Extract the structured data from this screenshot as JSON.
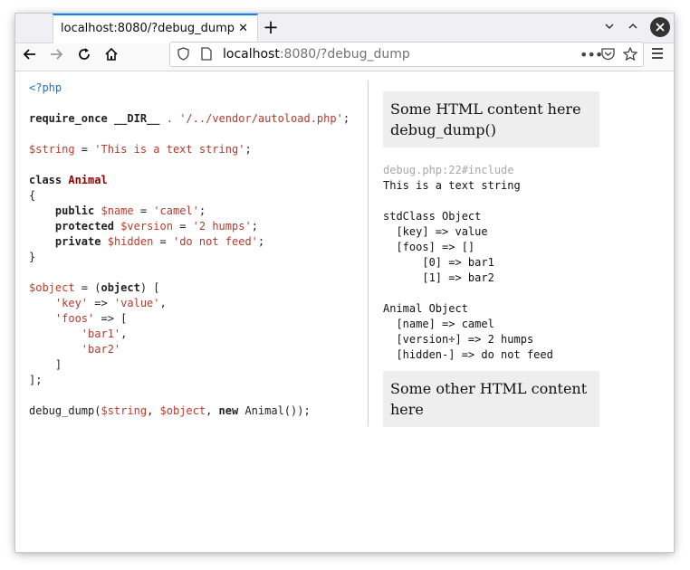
{
  "browser": {
    "tab_title": "localhost:8080/?debug_dump",
    "tab_close": "✕",
    "new_tab": "+",
    "url_host": "localhost",
    "url_rest": ":8080/?debug_dump",
    "buttons": {
      "back": "back-arrow-icon",
      "forward": "forward-arrow-icon",
      "reload": "reload-icon",
      "home": "home-icon",
      "page_actions": "ellipsis-icon",
      "pocket": "pocket-icon",
      "bookmark": "star-icon",
      "menu": "hamburger-icon"
    },
    "accent_color": "#0a84ff"
  },
  "code": {
    "open_tag": "<?php",
    "require_kw": "require_once",
    "dir_const": "__DIR__",
    "concat": " . ",
    "autoload_str": "'/../vendor/autoload.php'",
    "string_var": "$string",
    "string_val": "'This is a text string'",
    "class_kw": "class",
    "class_name": "Animal",
    "public_kw": "public",
    "name_var": "$name",
    "name_val": "'camel'",
    "protected_kw": "protected",
    "version_var": "$version",
    "version_val": "'2 humps'",
    "private_kw": "private",
    "hidden_var": "$hidden",
    "hidden_val": "'do not feed'",
    "object_var": "$object",
    "object_cast": "object",
    "key_str": "'key'",
    "value_str": "'value'",
    "foos_str": "'foos'",
    "bar1_str": "'bar1'",
    "bar2_str": "'bar2'",
    "call_fn": "debug_dump(",
    "new_kw": "new",
    "new_class": " Animal());"
  },
  "output": {
    "block1_line1": "Some HTML content here",
    "block1_line2": "debug_dump()",
    "source": "debug.php:22#include",
    "dump_lines": [
      "This is a text string",
      "",
      "stdClass Object",
      "  [key] => value",
      "  [foos] => []",
      "      [0] => bar1",
      "      [1] => bar2",
      "",
      "Animal Object",
      "  [name] => camel",
      "  [version÷] => 2 humps",
      "  [hidden-] => do not feed"
    ],
    "block2": "Some other HTML content here"
  }
}
